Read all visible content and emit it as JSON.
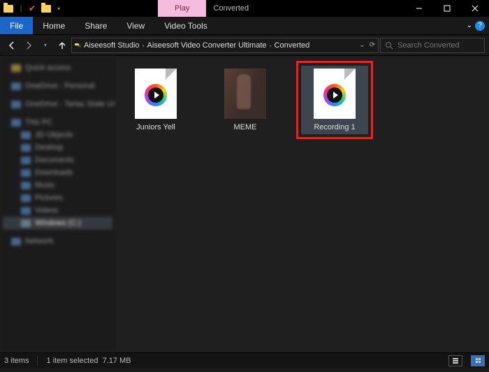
{
  "window": {
    "title": "Converted",
    "contextual_tab": "Play",
    "contextual_group": "Video Tools"
  },
  "ribbon": {
    "file": "File",
    "tabs": [
      "Home",
      "Share",
      "View",
      "Video Tools"
    ]
  },
  "address": {
    "segments": [
      "Aiseesoft Studio",
      "Aiseesoft Video Converter Ultimate",
      "Converted"
    ],
    "search_placeholder": "Search Converted"
  },
  "navpane": {
    "items": [
      {
        "label": "Quick access",
        "level": 1,
        "icon": "yel"
      },
      {
        "label": "OneDrive - Personal",
        "level": 1,
        "icon": "blue"
      },
      {
        "label": "OneDrive - Tarlac State Un",
        "level": 1,
        "icon": "blue"
      },
      {
        "label": "This PC",
        "level": 1,
        "icon": "blue"
      },
      {
        "label": "3D Objects",
        "level": 2,
        "icon": "blue"
      },
      {
        "label": "Desktop",
        "level": 2,
        "icon": "blue"
      },
      {
        "label": "Documents",
        "level": 2,
        "icon": "blue"
      },
      {
        "label": "Downloads",
        "level": 2,
        "icon": "blue"
      },
      {
        "label": "Music",
        "level": 2,
        "icon": "blue"
      },
      {
        "label": "Pictures",
        "level": 2,
        "icon": "blue"
      },
      {
        "label": "Videos",
        "level": 2,
        "icon": "blue"
      },
      {
        "label": "Windows (C:)",
        "level": 2,
        "icon": "dr",
        "selected": true
      },
      {
        "label": "Network",
        "level": 1,
        "icon": "blue"
      }
    ]
  },
  "files": [
    {
      "name": "Juniors Yell",
      "kind": "video",
      "selected": false,
      "highlight": false
    },
    {
      "name": "MEME",
      "kind": "photo",
      "selected": false,
      "highlight": false
    },
    {
      "name": "Recording 1",
      "kind": "video",
      "selected": true,
      "highlight": true
    }
  ],
  "status": {
    "count_label": "3 items",
    "selection_label": "1 item selected",
    "size_label": "7.17 MB"
  }
}
